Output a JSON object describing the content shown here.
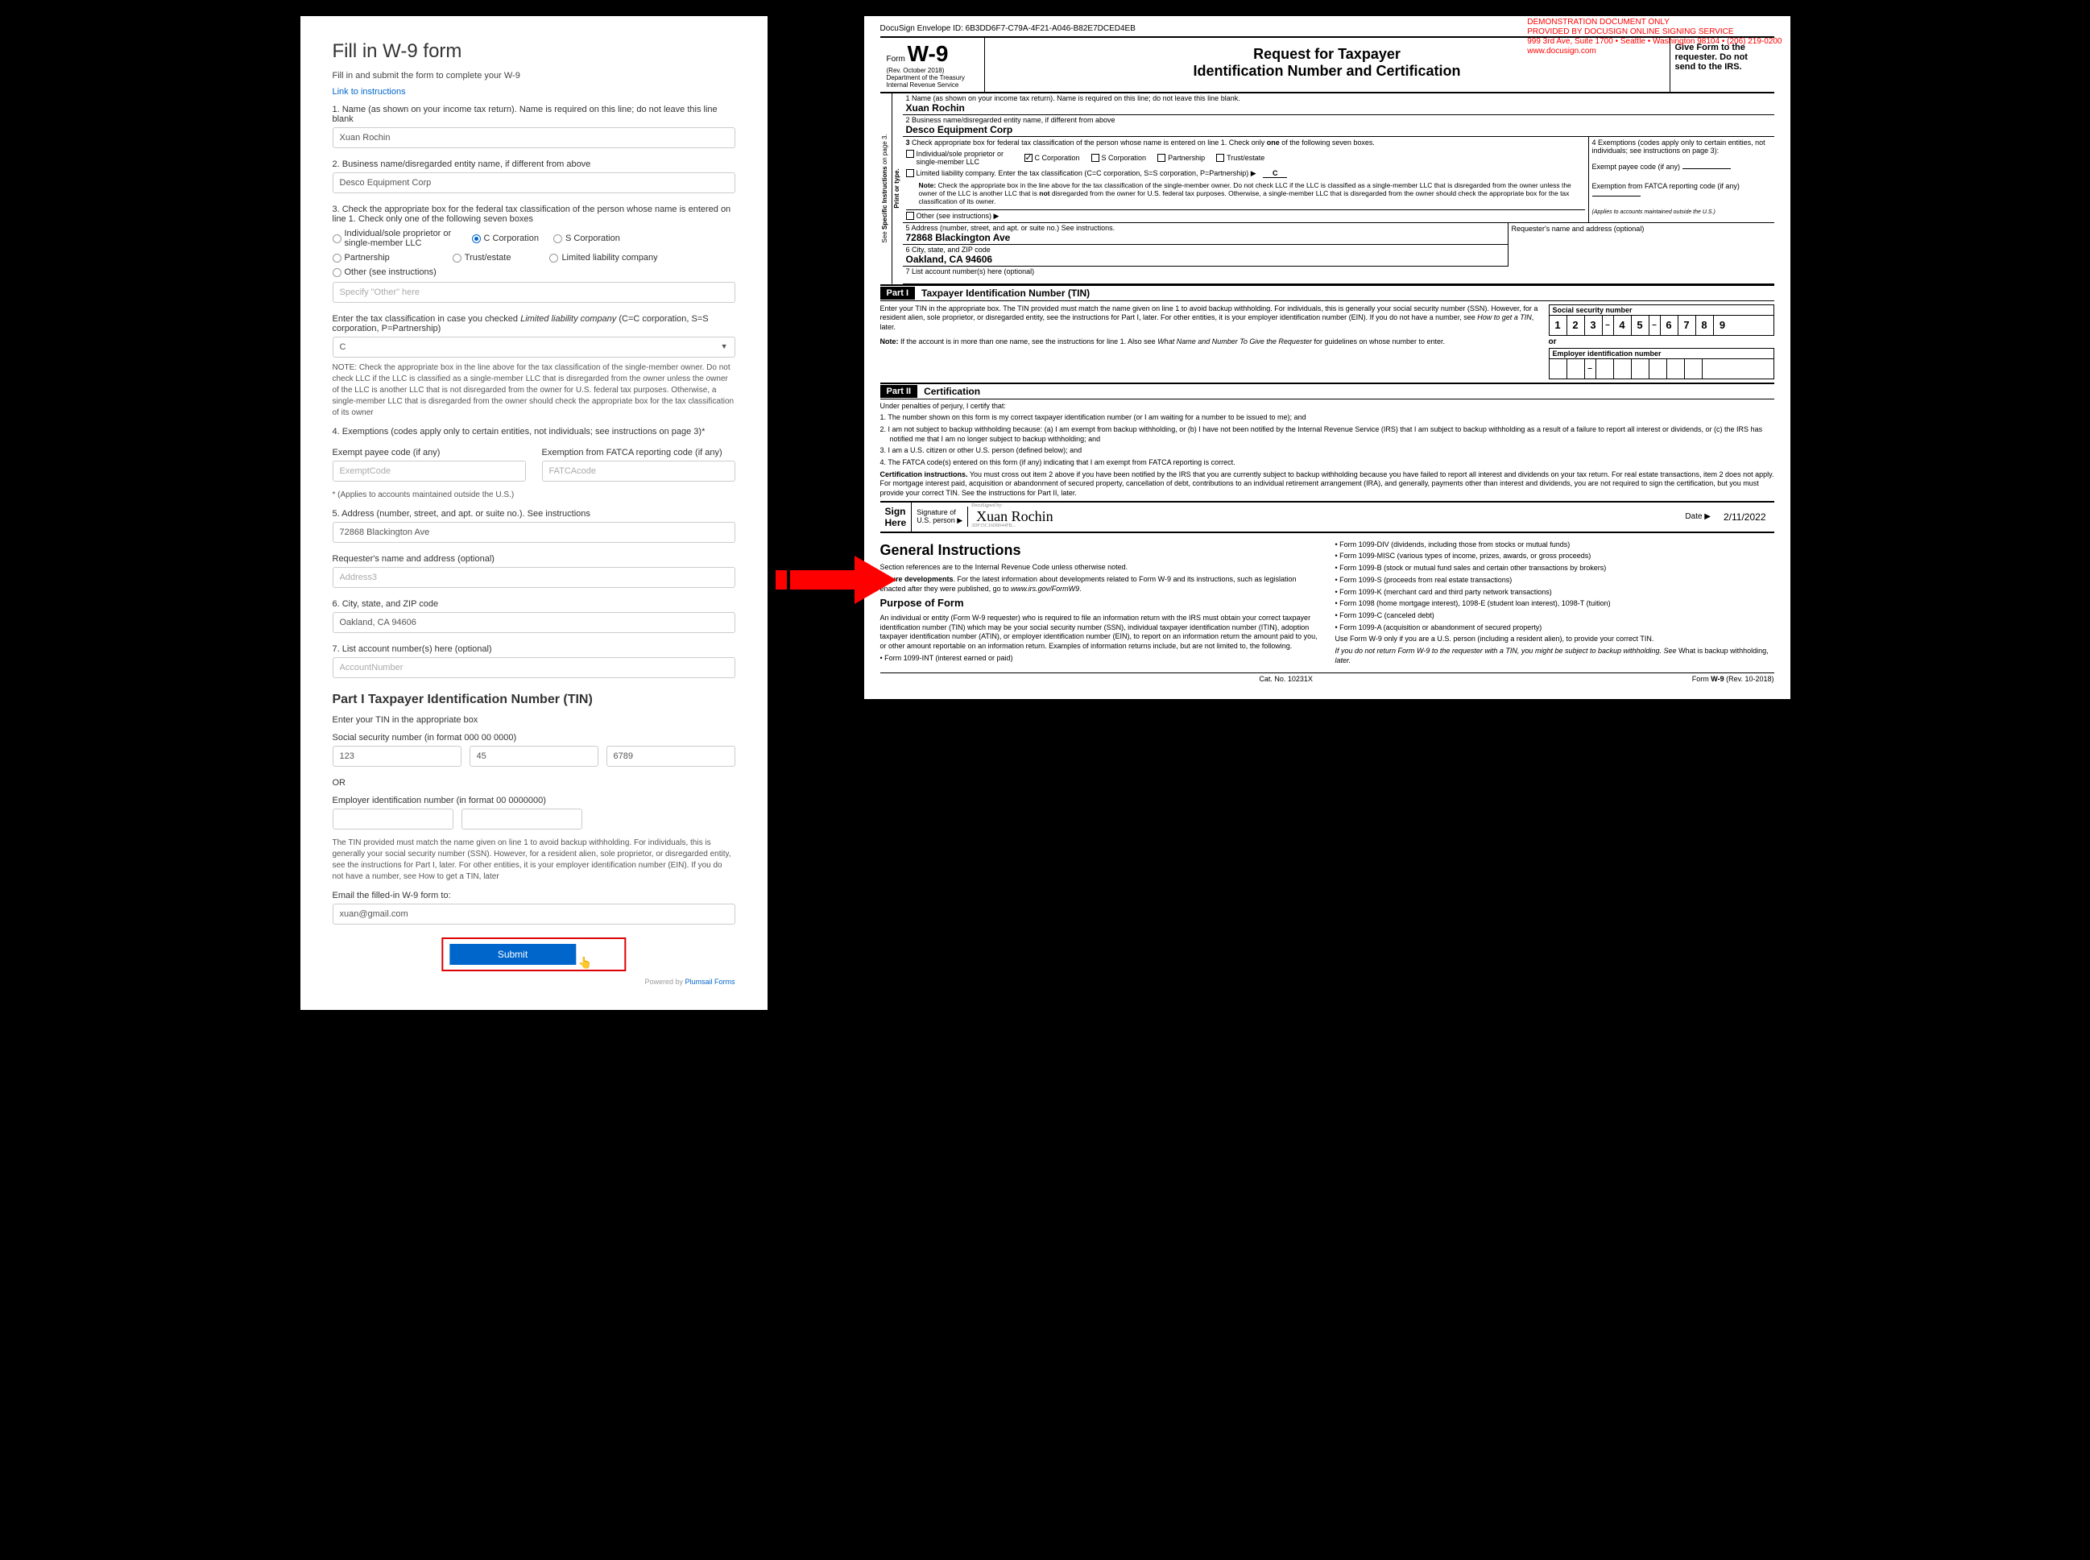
{
  "left": {
    "title": "Fill in W-9 form",
    "subtitle": "Fill in and submit the form to complete your W-9",
    "linkText": "Link to instructions",
    "l1": "1. Name (as shown on your income tax return). Name is required on this line; do not leave this line blank",
    "v1": "Xuan Rochin",
    "l2": "2. Business name/disregarded entity name, if different from above",
    "v2": "Desco Equipment Corp",
    "l3": "3. Check the appropriate box for the federal tax classification of the person whose name is entered on line 1. Check only one of the following seven boxes",
    "r1": "Individual/sole proprietor or single-member LLC",
    "r2": "C Corporation",
    "r3": "S Corporation",
    "r4": "Partnership",
    "r5": "Trust/estate",
    "r6": "Limited liability company",
    "r7": "Other (see instructions)",
    "otherPh": "Specify \"Other\" here",
    "llcLabel": "Enter the tax classification in case you checked Limited liability company (C=C corporation, S=S corporation, P=Partnership)",
    "llcVal": "C",
    "note3": "NOTE: Check the appropriate box in the line above for the tax classification of the single-member owner.  Do not check LLC if the LLC is classified as a single-member LLC that is disregarded from the owner unless the owner of the LLC is another LLC that is not disregarded from the owner for U.S. federal tax purposes. Otherwise, a single-member LLC that is disregarded from the owner should check the appropriate box for the tax classification of its owner",
    "l4": "4. Exemptions (codes apply only to certain entities, not individuals; see instructions on page 3)*",
    "l4a": "Exempt payee code (if any)",
    "l4b": "Exemption from FATCA reporting  code (if any)",
    "ph4a": "ExemptCode",
    "ph4b": "FATCAcode",
    "l4note": "* (Applies to accounts maintained outside the U.S.)",
    "l5": "5. Address (number, street, and apt. or suite no.). See instructions",
    "v5": "72868 Blackington Ave",
    "lReq": "Requester's name and address (optional)",
    "phReq": "Address3",
    "l6": "6. City, state, and ZIP code",
    "v6": "Oakland, CA 94606",
    "l7": "7. List account number(s) here (optional)",
    "ph7": "AccountNumber",
    "partI": "Part I Taxpayer Identification Number (TIN)",
    "partISub": "Enter your TIN in the appropriate box",
    "ssnLabel": "Social security number (in format 000 00 0000)",
    "ssn1": "123",
    "ssn2": "45",
    "ssn3": "6789",
    "or": "OR",
    "einLabel": "Employer identification number (in format 00 0000000)",
    "tinNote": "The TIN provided must match the name given on line 1 to avoid backup withholding. For individuals, this is generally your social security number (SSN). However, for a resident alien, sole proprietor, or disregarded entity, see the instructions for Part I, later. For other entities, it is your employer identification number (EIN). If you do not have a number, see How to get a TIN, later",
    "emailLabel": "Email the filled-in W-9 form to:",
    "emailVal": "xuan@gmail.com",
    "submit": "Submit",
    "powered": "Powered by ",
    "poweredLink": "Plumsail Forms"
  },
  "right": {
    "demo1": "DEMONSTRATION DOCUMENT ONLY",
    "demo2": "PROVIDED BY DOCUSIGN ONLINE SIGNING SERVICE",
    "demo3": "999 3rd Ave, Suite 1700 • Seattle • Washington 98104 • (206) 219-0200",
    "demo4": "www.docusign.com",
    "envelopeId": "DocuSign Envelope ID: 6B3DD6F7-C79A-4F21-A046-B82E7DCED4EB",
    "formLabel": "Form",
    "w9": "W-9",
    "rev": "(Rev. October 2018)",
    "dept": "Department of the Treasury",
    "irs": "Internal Revenue Service",
    "title1": "Request for Taxpayer",
    "title2": "Identification Number and Certification",
    "giveForm": "Give Form to the requester. Do not send to the IRS.",
    "row1Label": "1  Name (as shown on your income tax return). Name is required on this line; do not leave this line blank.",
    "row1Val": "Xuan Rochin",
    "row2Label": "2  Business name/disregarded entity name, if different from above",
    "row2Val": "Desco Equipment Corp",
    "sideTab1": "Print or type.",
    "sideTab2": "See Specific Instructions on page 3.",
    "box3Label": "3  Check appropriate box for federal tax classification of the person whose name is entered on line 1. Check only one of the following seven boxes.",
    "cb1": "Individual/sole proprietor or single-member LLC",
    "cb2": "C Corporation",
    "cb3": "S Corporation",
    "cb4": "Partnership",
    "cb5": "Trust/estate",
    "cb6": "Limited liability company. Enter the tax classification (C=C corporation, S=S corporation, P=Partnership) ▶",
    "cb6val": "C",
    "cb6note": "Note: Check the appropriate box in the line above for the tax classification of the single-member owner.  Do not check LLC if the LLC is classified as a single-member LLC that is disregarded from the owner unless the owner of the LLC is another LLC that is not disregarded from the owner for U.S. federal tax purposes. Otherwise, a single-member LLC that is disregarded from the owner should check the appropriate box for the tax classification of its owner.",
    "cb7": "Other (see instructions) ▶",
    "box4Label": "4  Exemptions (codes apply only to certain entities, not individuals; see instructions on page 3):",
    "box4a": "Exempt payee code (if any)",
    "box4b": "Exemption from FATCA reporting code (if any)",
    "box4note": "(Applies to accounts maintained outside the U.S.)",
    "row5Label": "5  Address (number, street, and apt. or suite no.) See instructions.",
    "row5Val": "72868 Blackington Ave",
    "row5req": "Requester's name and address (optional)",
    "row6Label": "6  City, state, and ZIP code",
    "row6Val": "Oakland, CA 94606",
    "row7Label": "7  List account number(s) here (optional)",
    "partI": "Part I",
    "partITitle": "Taxpayer Identification Number (TIN)",
    "tinText1": "Enter your TIN in the appropriate box. The TIN provided must match the name given on line 1 to avoid backup withholding. For individuals, this is generally your social security number (SSN). However, for a resident alien, sole proprietor, or disregarded entity, see the instructions for Part I, later. For other entities, it is your employer identification number (EIN). If you do not have a number, see How to get a TIN, later.",
    "tinText2": "Note: If the account is in more than one name, see the instructions for line 1. Also see What Name and Number To Give the Requester for guidelines on whose number to enter.",
    "ssnLabel": "Social security number",
    "ssn": [
      "1",
      "2",
      "3",
      "4",
      "5",
      "6",
      "7",
      "8",
      "9"
    ],
    "or": "or",
    "einLabel": "Employer identification number",
    "partII": "Part II",
    "partIITitle": "Certification",
    "certIntro": "Under penalties of perjury, I certify that:",
    "cert1": "1. The number shown on this form is my correct taxpayer identification number (or I am waiting for a number to be issued to me); and",
    "cert2": "2. I am not subject to backup withholding because: (a) I am exempt from backup withholding, or (b) I have not been notified by the Internal Revenue Service (IRS) that I am subject to backup withholding as a result of a failure to report all interest or dividends, or (c) the IRS has notified me that I am no longer subject to backup withholding; and",
    "cert3": "3. I am a U.S. citizen or other U.S. person (defined below); and",
    "cert4": "4. The FATCA code(s) entered on this form (if any) indicating that I am exempt from FATCA reporting is correct.",
    "certInst": "Certification instructions. You must cross out item 2 above if you have been notified by the IRS that you are currently subject to backup withholding because you have failed to report all interest and dividends on your tax return. For real estate transactions, item 2 does not apply. For mortgage interest paid, acquisition or abandonment of secured property, cancellation of debt, contributions to an individual retirement arrangement (IRA), and generally, payments other than interest and dividends, you are not required to sign the certification, but you must provide your correct TIN. See the instructions for Part II, later.",
    "signHere": "Sign Here",
    "sigOf": "Signature of U.S. person ▶",
    "signature": "Xuan Rochin",
    "dsStamp": "DocuSigned by:",
    "dsId": "3DF15C16D0044FB...",
    "dateLabel": "Date ▶",
    "dateVal": "2/11/2022",
    "genTitle": "General Instructions",
    "gen1": "Section references are to the Internal Revenue Code unless otherwise noted.",
    "gen2": "Future developments. For the latest information about developments related to Form W-9 and its instructions, such as legislation enacted after they were published, go to www.irs.gov/FormW9.",
    "purposeTitle": "Purpose of Form",
    "purpose1": "An individual or entity (Form W-9 requester) who is required to file an information return with the IRS must obtain your correct taxpayer identification number (TIN) which may be your social security number (SSN), individual taxpayer identification number (ITIN), adoption taxpayer identification number (ATIN), or employer identification number (EIN), to report on an information return the amount paid to you, or other amount reportable on an information return. Examples of information returns include, but are not limited to, the following.",
    "b1": "• Form 1099-INT (interest earned or paid)",
    "b2": "• Form 1099-DIV (dividends, including those from stocks or mutual funds)",
    "b3": "• Form 1099-MISC (various types of income, prizes, awards, or gross proceeds)",
    "b4": "• Form 1099-B (stock or mutual fund sales and certain other transactions by brokers)",
    "b5": "• Form 1099-S (proceeds from real estate transactions)",
    "b6": "• Form 1099-K (merchant card and third party network transactions)",
    "b7": "• Form 1098 (home mortgage interest), 1098-E (student loan interest), 1098-T (tuition)",
    "b8": "• Form 1099-C (canceled debt)",
    "b9": "• Form 1099-A (acquisition or abandonment of secured property)",
    "b10": "   Use Form W-9 only if you are a U.S. person (including a resident alien), to provide your correct TIN.",
    "b11": "   If you do not return Form W-9 to the requester with a TIN, you might be subject to backup withholding. See What is backup withholding, later.",
    "catNo": "Cat. No. 10231X",
    "formFooter": "Form W-9 (Rev. 10-2018)"
  }
}
